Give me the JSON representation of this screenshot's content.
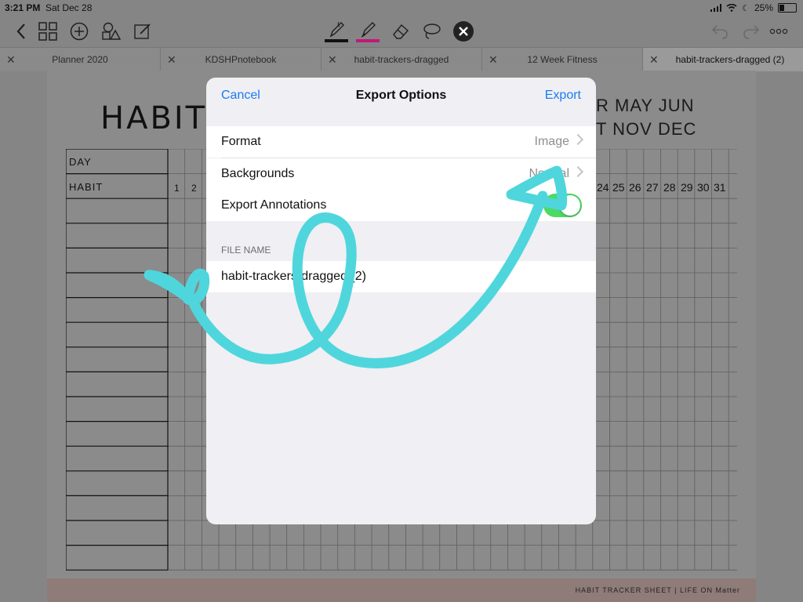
{
  "status": {
    "time": "3:21 PM",
    "date": "Sat Dec 28",
    "battery": "25%"
  },
  "toolbar": {
    "left_icons": [
      "back-chevron-icon",
      "grid-icon",
      "add-icon",
      "shapes-icon",
      "edit-icon"
    ],
    "tools": [
      "pen-icon",
      "highlighter-icon",
      "eraser-icon",
      "lasso-icon",
      "close-circle-icon"
    ],
    "right_icons": [
      "undo-icon",
      "redo-icon",
      "more-icon"
    ],
    "colors": {
      "pen": "#111111",
      "highlighter": "#c2187a"
    }
  },
  "tabs": [
    {
      "label": "Planner 2020"
    },
    {
      "label": "KDSHPnotebook"
    },
    {
      "label": "habit-trackers-dragged"
    },
    {
      "label": "12 Week Fitness"
    },
    {
      "label": "habit-trackers-dragged (2)"
    }
  ],
  "page": {
    "title": "HABIT",
    "months_line1": "R  MAY JUN",
    "months_line2": "T  NOV DEC",
    "row_day": "DAY",
    "row_habit": "HABIT",
    "day_numbers_left": [
      "1",
      "2"
    ],
    "day_numbers_right": [
      "24",
      "25",
      "26",
      "27",
      "28",
      "29",
      "30",
      "31"
    ],
    "footer": "HABIT TRACKER SHEET | LIFE ON Matter"
  },
  "dialog": {
    "cancel": "Cancel",
    "title": "Export Options",
    "export": "Export",
    "format_label": "Format",
    "format_value": "Image",
    "backgrounds_label": "Backgrounds",
    "backgrounds_value": "Normal",
    "annotations_label": "Export Annotations",
    "annotations_on": true,
    "file_name_header": "FILE NAME",
    "file_name": "habit-trackers-dragged (2)"
  },
  "colors": {
    "link": "#1b7cf2",
    "toggle_on": "#4cd964",
    "annotation": "#4fd6dc"
  }
}
